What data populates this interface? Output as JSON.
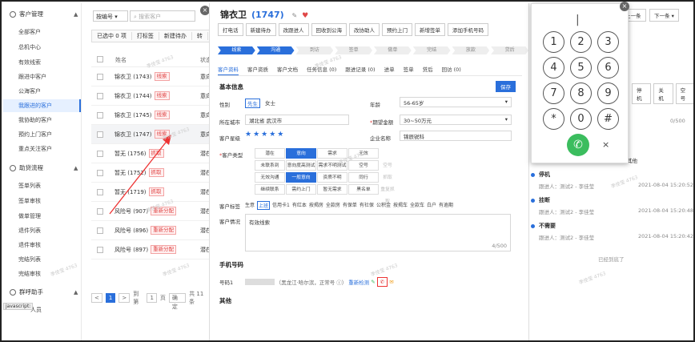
{
  "sidebar": {
    "sec1": "客户管理",
    "items": [
      "全部客户",
      "总机中心",
      "有效线索",
      "跟进中客户",
      "公海客户",
      "我跟进的客户",
      "我协助的客户",
      "預约上门客户",
      "重点关注客户"
    ],
    "sec2": "助贷流程",
    "items2": [
      "签单列表",
      "签单审核",
      "做单管理",
      "退件列表",
      "退件审核",
      "完结列表",
      "完结审核"
    ],
    "sec3": "群呼助手",
    "items3": [
      "人员"
    ],
    "statusbar": "javascript:"
  },
  "list": {
    "select_value": "按编号",
    "search_placeholder": "搜索客户",
    "toolbar": [
      "已选中 0 项",
      "打标签",
      "新建待办",
      "转"
    ],
    "col_name": "姓名",
    "col_status": "状态",
    "rows": [
      {
        "name": "锦衣卫 (1743)",
        "tag": "线索",
        "status": "意向"
      },
      {
        "name": "锦衣卫 (1744)",
        "tag": "线索",
        "status": "意向"
      },
      {
        "name": "锦衣卫 (1745)",
        "tag": "线索",
        "status": "意向"
      },
      {
        "name": "锦衣卫 (1747)",
        "tag": "线索",
        "status": "意向"
      },
      {
        "name": "暂无 (1756)",
        "tag": "抓取",
        "status": "潜在"
      },
      {
        "name": "暂无 (1752)",
        "tag": "抓取",
        "status": "潜在"
      },
      {
        "name": "暂无 (1719)",
        "tag": "抓取",
        "status": "潜在"
      },
      {
        "name": "风险号 (907)",
        "tag": "重新分配",
        "status": "潜在"
      },
      {
        "name": "风险号 (896)",
        "tag": "重新分配",
        "status": "潜在"
      },
      {
        "name": "风险号 (897)",
        "tag": "重新分配",
        "status": "潜在"
      }
    ],
    "pager": {
      "prev": "<",
      "page": "1",
      "next": ">",
      "goto": "到第",
      "page_input": "1",
      "page_unit": "页",
      "confirm": "确定",
      "total": "共 11 条"
    }
  },
  "detail": {
    "title": "锦衣卫",
    "id": "(1747)",
    "actions": [
      "打电话",
      "新建待办",
      "改跟进人",
      "回收到公海",
      "改协助人",
      "预约上门",
      "新增签单",
      "添加手机号码"
    ],
    "steps": [
      "线索",
      "沟通",
      "到访",
      "签单",
      "做单",
      "完结",
      "放款",
      "贷后"
    ],
    "tabs": [
      "客户资料",
      "客户资质",
      "客户文档",
      "任务信息 (0)",
      "跟进记录 (0)",
      "进单",
      "签单",
      "贷后",
      "回访 (0)"
    ],
    "basic_info": "基本信息",
    "save": "保存",
    "gender_label": "性别",
    "gender_opts": [
      "先生",
      "女士"
    ],
    "age_label": "年龄",
    "age_value": "56-65岁",
    "city_label": "所在城市",
    "city_value": "湖北省    武汉市",
    "loan_label": "期望金额",
    "loan_value": "30~50万元",
    "star_label": "客户星级",
    "stars": "★★★★★",
    "company_label": "企业名称",
    "company_value": "锦辰锐科",
    "type_label": "客户类型",
    "types": [
      {
        "t": "潜在",
        "s": ""
      },
      {
        "t": "意向",
        "s": "on"
      },
      {
        "t": "需求",
        "s": ""
      },
      {
        "t": "无效",
        "s": ""
      },
      {
        "t": "",
        "s": "blank"
      },
      {
        "t": "未联系到",
        "s": ""
      },
      {
        "t": "意向度高测试",
        "s": ""
      },
      {
        "t": "需求不明测试",
        "s": ""
      },
      {
        "t": "空号",
        "s": ""
      },
      {
        "t": "",
        "s": "blank"
      },
      {
        "t": "无效沟通",
        "s": ""
      },
      {
        "t": "一般意向",
        "s": "on"
      },
      {
        "t": "资质不明",
        "s": ""
      },
      {
        "t": "同行",
        "s": ""
      },
      {
        "t": "",
        "s": "blank"
      },
      {
        "t": "继续联系",
        "s": ""
      },
      {
        "t": "需约上门",
        "s": ""
      },
      {
        "t": "暂无需求",
        "s": ""
      },
      {
        "t": "黑名单",
        "s": ""
      },
      {
        "t": "",
        "s": "blank"
      }
    ],
    "types_dim": [
      "空号",
      "抓取",
      "重复抓取"
    ],
    "tag_label": "客户标签",
    "tags": [
      "生意",
      "上班",
      "信用卡1",
      "有红本",
      "按揭房",
      "全款房",
      "有保单",
      "有社保",
      "公积金",
      "按揭车",
      "全款车",
      "白户",
      "有逾期"
    ],
    "tag_active": "上班",
    "situation_label": "客户情况",
    "situation_value": "有效线索",
    "situation_count": "4/500",
    "phone_section": "手机号码",
    "phone_label": "号码1",
    "phone_masked": "1**********",
    "phone_detail": "（黑龙江·哈尔滨，正常号 ⓘ）",
    "recheck": "重新检测",
    "other_section": "其他"
  },
  "farright": {
    "prev": "上一条",
    "next": "下一条",
    "quick_btns": [
      "停机",
      "关机",
      "空号"
    ],
    "count": "0/500",
    "other": "其他",
    "timeline": [
      {
        "title": "停机",
        "who": "跟进人：测试2 - 李佳莹",
        "time": "2021-08-04 15:20:52"
      },
      {
        "title": "挂断",
        "who": "跟进人：测试2 - 李佳莹",
        "time": "2021-08-04 15:20:48"
      },
      {
        "title": "不需要",
        "who": "跟进人：测试2 - 李佳莹",
        "time": "2021-08-04 15:20:42"
      }
    ],
    "end": "已经到底了"
  },
  "dialpad": {
    "display": "|",
    "keys": [
      "1",
      "2",
      "3",
      "4",
      "5",
      "6",
      "7",
      "8",
      "9",
      "*",
      "0",
      "#"
    ],
    "close": "×"
  },
  "colors": {
    "accent": "#2a6fdb",
    "red": "#e04848",
    "green": "#3bbd5e"
  }
}
